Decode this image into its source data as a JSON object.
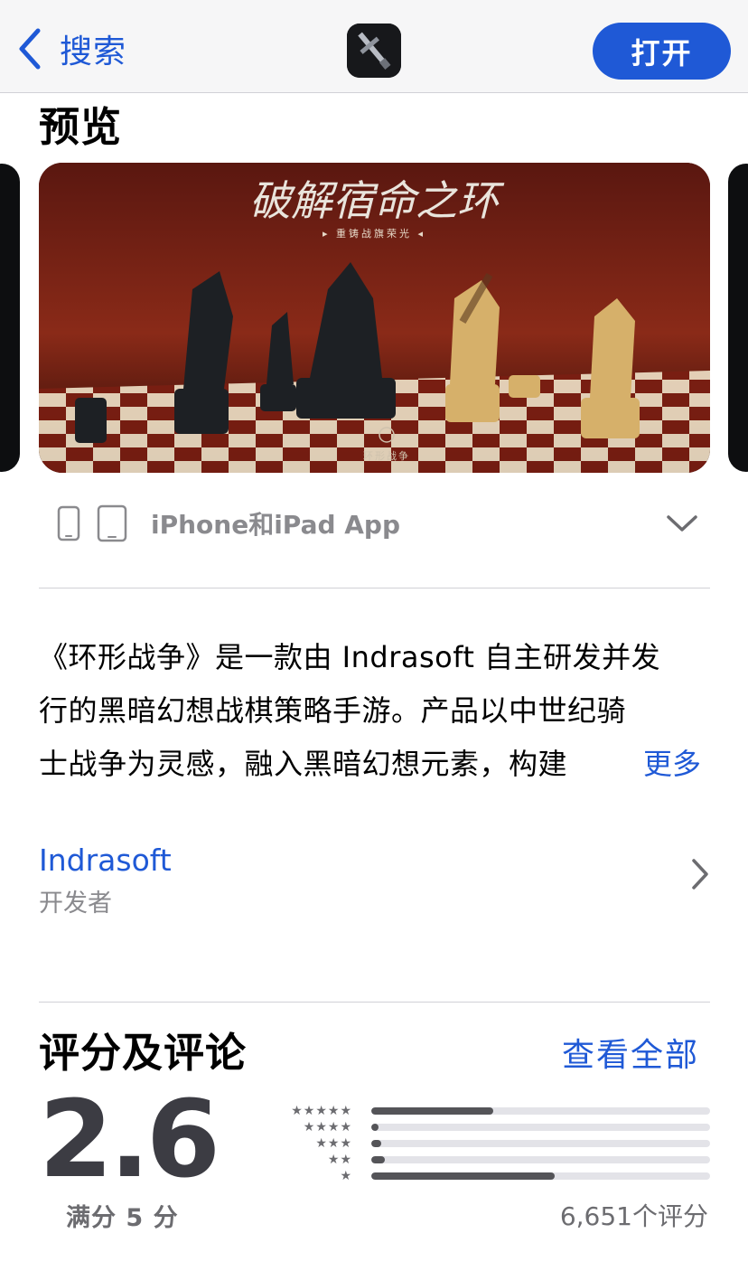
{
  "nav": {
    "back_label": "搜索",
    "open_label": "打开"
  },
  "preview": {
    "title": "预览",
    "screenshot_title": "破解宿命之环",
    "screenshot_subtitle": "▸ 重铸战旗荣光 ◂",
    "screenshot_watermark": "环形战争"
  },
  "devices": {
    "label": "iPhone和iPad App"
  },
  "description": {
    "lines": [
      "《环形战争》是一款由 Indrasoft 自主研发并发",
      "行的黑暗幻想战棋策略手游。产品以中世纪骑",
      "士战争为灵感，融入黑暗幻想元素，构建"
    ],
    "more_label": "更多"
  },
  "developer": {
    "name": "Indrasoft",
    "caption": "开发者"
  },
  "ratings": {
    "title": "评分及评论",
    "see_all": "查看全部",
    "score": "2.6",
    "out_of": "满分 5 分",
    "count": "6,651个评分",
    "histogram": [
      {
        "stars": "★★★★★",
        "fraction": 0.36
      },
      {
        "stars": "★★★★",
        "fraction": 0.02
      },
      {
        "stars": "★★★",
        "fraction": 0.03
      },
      {
        "stars": "★★",
        "fraction": 0.04
      },
      {
        "stars": "★",
        "fraction": 0.54
      }
    ]
  },
  "colors": {
    "accent": "#1f59d6",
    "secondary_text": "#8a8a8e",
    "bar_fill": "#545458",
    "bar_track": "#e3e3e8"
  }
}
